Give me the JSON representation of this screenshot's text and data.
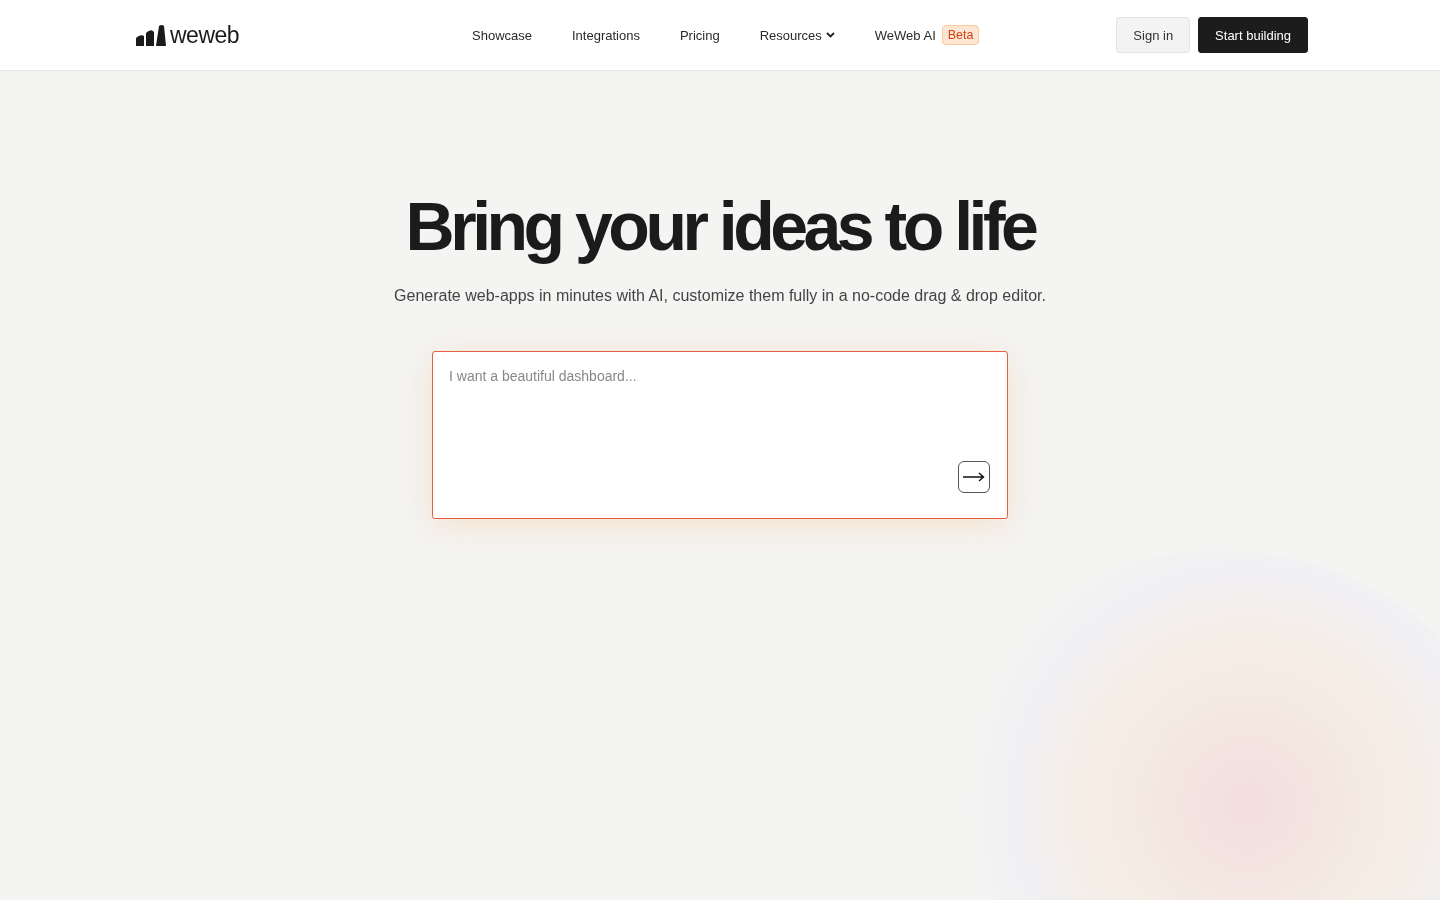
{
  "header": {
    "logo": "weweb",
    "nav": [
      {
        "label": "Showcase",
        "kind": "link"
      },
      {
        "label": "Integrations",
        "kind": "link"
      },
      {
        "label": "Pricing",
        "kind": "link"
      },
      {
        "label": "Resources",
        "kind": "dropdown"
      },
      {
        "label": "WeWeb AI",
        "kind": "badge",
        "badge": "Beta"
      }
    ],
    "buttons": [
      {
        "label": "Sign in",
        "kind": "secondary"
      },
      {
        "label": "Start building",
        "kind": "primary"
      }
    ]
  },
  "hero": {
    "title": "Bring your ideas to life",
    "subtitle": "Generate web-apps in minutes with AI, customize them fully in a no-code drag & drop editor.",
    "prompt": {
      "placeholder": "I want a beautiful dashboard..."
    }
  }
}
